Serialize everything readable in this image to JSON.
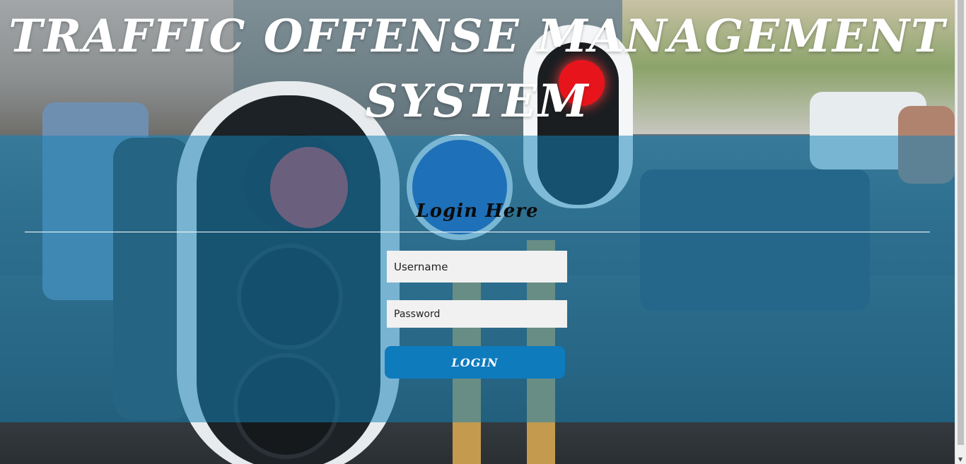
{
  "header": {
    "title_line1": "TRAFFIC OFFENSE MANAGEMENT",
    "title_line2": "SYSTEM"
  },
  "login": {
    "heading": "Login Here",
    "username_placeholder": "Username",
    "password_placeholder": "Password",
    "button_label": "LOGIN"
  },
  "colors": {
    "band": "#1482b9",
    "button": "#0e7bbd",
    "title": "#ffffff"
  },
  "scrollbar": {
    "up_arrow": "▲",
    "down_arrow": "▼"
  }
}
